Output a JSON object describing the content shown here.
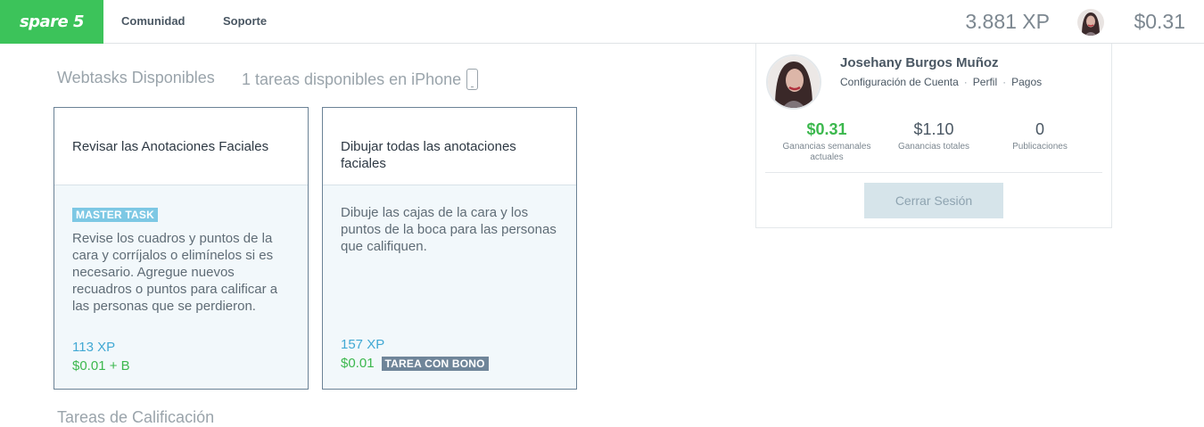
{
  "header": {
    "logo": "spare 5",
    "nav": [
      "Comunidad",
      "Soporte"
    ],
    "xp": "3.881 XP",
    "balance": "$0.31"
  },
  "main": {
    "heading_webtasks": "Webtasks Disponibles",
    "heading_iphone": "1 tareas disponibles en iPhone",
    "cards": [
      {
        "title": "Revisar las Anotaciones Faciales",
        "badge": "MASTER TASK",
        "description": "Revise los cuadros y puntos de la cara y corríjalos o elimínelos si es necesario. Agregue nuevos recuadros o puntos para calificar a las personas que se perdieron.",
        "xp": "113 XP",
        "pay": "$0.01 + B"
      },
      {
        "title": "Dibujar todas las anotaciones faciales",
        "description": "Dibuje las cajas de la cara y los puntos de la boca para las personas que califiquen.",
        "xp": "157 XP",
        "pay": "$0.01",
        "badge": "TAREA CON BONO"
      }
    ],
    "bottom_heading": "Tareas de Calificación"
  },
  "profile": {
    "name": "Josehany Burgos Muñoz",
    "links": [
      "Configuración de Cuenta",
      "Perfil",
      "Pagos"
    ],
    "separator": "·",
    "stats": [
      {
        "value": "$0.31",
        "label": "Ganancias semanales actuales"
      },
      {
        "value": "$1.10",
        "label": "Ganancias totales"
      },
      {
        "value": "0",
        "label": "Publicaciones"
      }
    ],
    "logout": "Cerrar Sesión"
  },
  "colors": {
    "brand_green": "#3cc35a",
    "xp_blue": "#42a9d4",
    "master_badge": "#7dc8e4",
    "bonus_badge": "#6f8599"
  },
  "icons": [
    "phone-icon",
    "avatar"
  ]
}
